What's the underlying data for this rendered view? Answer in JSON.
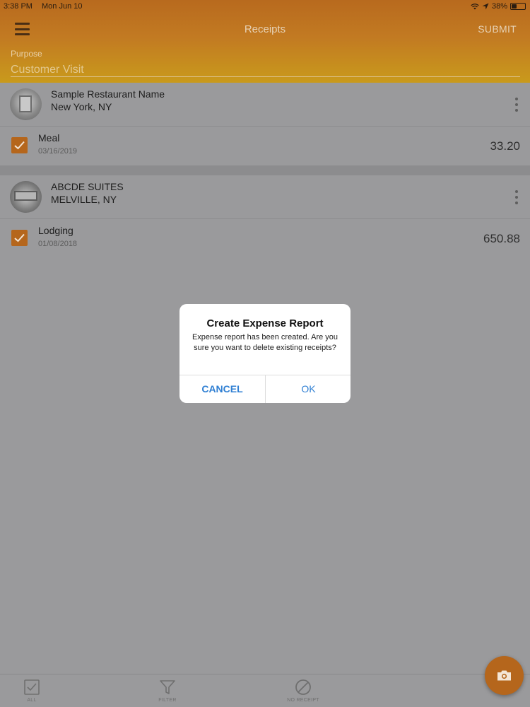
{
  "status_bar": {
    "time": "3:38 PM",
    "date": "Mon Jun 10",
    "battery": "38%",
    "battery_level": 0.38
  },
  "nav": {
    "title": "Receipts",
    "submit_label": "SUBMIT",
    "menu_icon": "hamburger-icon"
  },
  "purpose": {
    "label": "Purpose",
    "value": "Customer Visit"
  },
  "receipts": [
    {
      "merchant": "Sample Restaurant Name",
      "location": "New York, NY",
      "category": "Meal",
      "date": "03/16/2019",
      "amount": "33.20",
      "checked": true
    },
    {
      "merchant": "ABCDE SUITES",
      "location": "MELVILLE, NY",
      "category": "Lodging",
      "date": "01/08/2018",
      "amount": "650.88",
      "checked": true
    }
  ],
  "tabs": [
    {
      "label": "ALL",
      "icon": "check-square-icon"
    },
    {
      "label": "FILTER",
      "icon": "filter-icon"
    },
    {
      "label": "NO RECEIPT",
      "icon": "no-receipt-icon"
    }
  ],
  "fab": {
    "icon": "camera-icon"
  },
  "dialog": {
    "title": "Create Expense Report",
    "message": "Expense report has been created. Are you sure you want to delete existing receipts?",
    "cancel_label": "CANCEL",
    "ok_label": "OK"
  },
  "colors": {
    "accent": "#b5661c",
    "header_top": "#b86a1e",
    "header_bottom": "#c99a1c",
    "link_blue": "#2f7fd3",
    "overlay": "#9a9a9c"
  }
}
